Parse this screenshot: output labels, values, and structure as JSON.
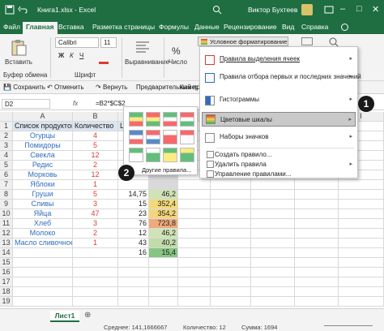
{
  "title": {
    "filename": "Книга1.xlsx - Excel",
    "user": "Виктор Бухтеев"
  },
  "menu": [
    "Файл",
    "Главная",
    "Вставка",
    "Разметка страницы",
    "Формулы",
    "Данные",
    "Рецензирование",
    "Вид",
    "Справка"
  ],
  "ribbon": {
    "paste": "Вставить",
    "clipboard": "Буфер обмена",
    "font_name": "Calibri",
    "font_size": "11",
    "font_group": "Шрифт",
    "align": "Выравнивание",
    "number": "Число",
    "cond_format": "Условное форматирование"
  },
  "qat": [
    "Сохранить",
    "Отменить",
    "Вернуть",
    "Предварительный просмотр",
    "Камера"
  ],
  "formula": {
    "cellref": "D2",
    "fx": "fx",
    "value": "=B2*$C$2"
  },
  "columns": [
    "A",
    "B",
    "C",
    "D",
    "E",
    "F",
    "G",
    "H",
    "I"
  ],
  "rows": [
    {
      "n": "1",
      "a": "Список продуктов",
      "b": "Количество",
      "c": "Ц",
      "d": ""
    },
    {
      "n": "2",
      "a": "Огурцы",
      "b": "4",
      "c": "",
      "d": ""
    },
    {
      "n": "3",
      "a": "Помидоры",
      "b": "5",
      "c": "",
      "d": ""
    },
    {
      "n": "4",
      "a": "Свекла",
      "b": "12",
      "c": "",
      "d": ""
    },
    {
      "n": "5",
      "a": "Редис",
      "b": "2",
      "c": "",
      "d": ""
    },
    {
      "n": "6",
      "a": "Морковь",
      "b": "12",
      "c": "",
      "d": ""
    },
    {
      "n": "7",
      "a": "Яблоки",
      "b": "1",
      "c": "",
      "d": ""
    },
    {
      "n": "8",
      "a": "Груши",
      "b": "5",
      "c": "14,75",
      "d": "46,2"
    },
    {
      "n": "9",
      "a": "Сливы",
      "b": "3",
      "c": "15",
      "d": "352,4"
    },
    {
      "n": "10",
      "a": "Яйца",
      "b": "47",
      "c": "23",
      "d": "354,2"
    },
    {
      "n": "11",
      "a": "Хлеб",
      "b": "3",
      "c": "76",
      "d": "723,8"
    },
    {
      "n": "12",
      "a": "Молоко",
      "b": "2",
      "c": "12",
      "d": "46,2"
    },
    {
      "n": "13",
      "a": "Масло сливочное",
      "b": "1",
      "c": "43",
      "d": "40,2"
    },
    {
      "n": "14",
      "a": "",
      "b": "",
      "c": "16",
      "d": "15,4"
    },
    {
      "n": "15",
      "a": "",
      "b": "",
      "c": "",
      "d": ""
    },
    {
      "n": "16",
      "a": "",
      "b": "",
      "c": "",
      "d": ""
    },
    {
      "n": "17",
      "a": "",
      "b": "",
      "c": "",
      "d": ""
    },
    {
      "n": "18",
      "a": "",
      "b": "",
      "c": "",
      "d": ""
    },
    {
      "n": "19",
      "a": "",
      "b": "",
      "c": "",
      "d": ""
    }
  ],
  "dropdown": {
    "items": [
      "Правила выделения ячеек",
      "Правила отбора первых и последних значений",
      "Гистограммы",
      "Цветовые шкалы",
      "Наборы значков",
      "Создать правило...",
      "Удалить правила",
      "Управление правилами..."
    ]
  },
  "submenu": {
    "more": "Другие правила..."
  },
  "badges": {
    "b1": "1",
    "b2": "2"
  },
  "sheet": {
    "tab": "Лист1"
  },
  "statusbar": {
    "avg": "Среднее: 141,1666667",
    "count": "Количество: 12",
    "sum": "Сумма: 1694"
  },
  "colors": {
    "excel_green": "#1e6e42",
    "accent_red": "#e03a2b",
    "name_blue": "#2f6ebd"
  }
}
